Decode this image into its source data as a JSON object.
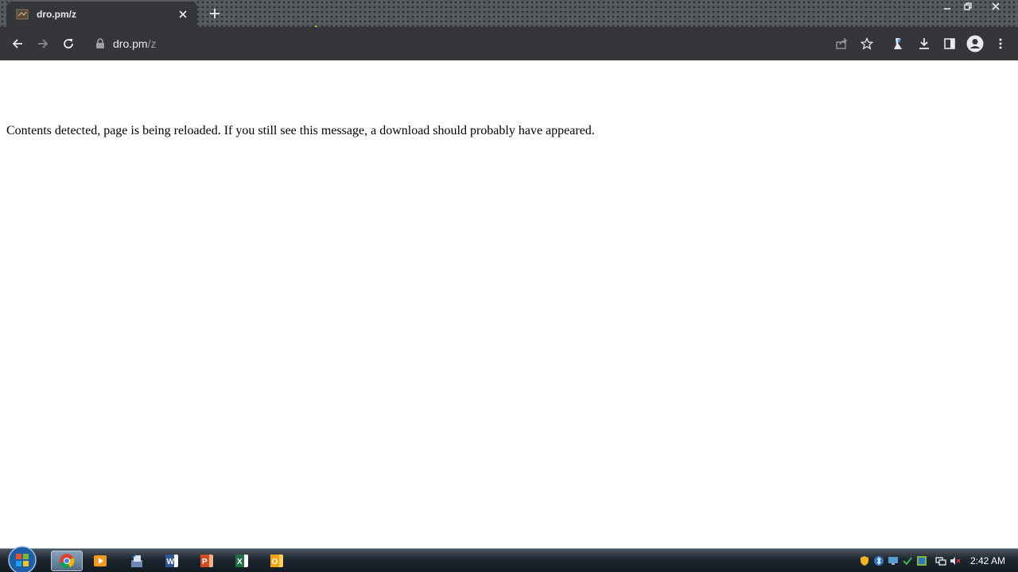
{
  "browser": {
    "tab": {
      "title": "dro.pm/z"
    },
    "url": {
      "host": "dro.pm",
      "path": "/z"
    }
  },
  "page": {
    "message": "Contents detected, page is being reloaded. If you still see this message, a download should probably have appeared."
  },
  "taskbar": {
    "apps": [
      "chrome",
      "media-player",
      "file-manager",
      "word",
      "powerpoint",
      "excel",
      "outlook"
    ],
    "clock": "2:42 AM"
  },
  "icons": [
    "back-icon",
    "forward-icon",
    "reload-icon",
    "lock-icon",
    "share-icon",
    "star-icon",
    "extension-icon",
    "download-icon",
    "side-panel-icon",
    "profile-icon",
    "menu-icon"
  ]
}
